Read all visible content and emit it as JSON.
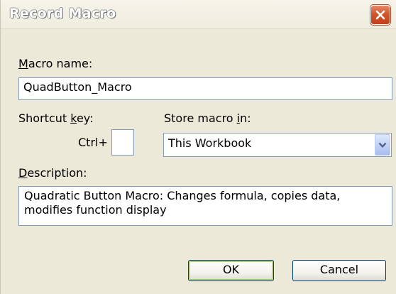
{
  "dialog": {
    "title": "Record Macro"
  },
  "macro_name": {
    "label_first": "M",
    "label_rest": "acro name:",
    "value": "QuadButton_Macro"
  },
  "shortcut": {
    "label_start": "Shortcut ",
    "label_underlined": "k",
    "label_end": "ey:",
    "prefix": "Ctrl+",
    "value": ""
  },
  "store": {
    "label_start": "Store macro ",
    "label_underlined": "i",
    "label_end": "n:",
    "selected": "This Workbook"
  },
  "description": {
    "label_first": "D",
    "label_rest": "escription:",
    "value": "Quadratic Button Macro:  Changes formula, copies data, modifies function display"
  },
  "buttons": {
    "ok_label": "OK",
    "cancel_label": "Cancel"
  },
  "icons": {
    "close": "close-icon",
    "dropdown": "chevron-down-icon"
  },
  "colors": {
    "dialog_bg": "#ece9d8",
    "field_border": "#7f9db9",
    "close_red": "#d4552e",
    "button_border": "#003c74"
  }
}
